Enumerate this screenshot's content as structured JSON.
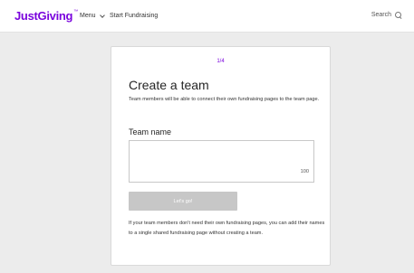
{
  "header": {
    "logo_text": "JustGiving",
    "logo_mark": "™",
    "menu_label": "Menu",
    "start_label": "Start Fundraising",
    "search_label": "Search"
  },
  "card": {
    "step": "1/4",
    "title": "Create a team",
    "description": "Team members will be able to connect their own fundraising pages to the team page.",
    "field_label": "Team name",
    "field_value": "",
    "char_count": "100",
    "button_label": "Let's go!",
    "note": "If your team members don't need their own fundraising pages, you can add their names to a single shared fundraising page without creating a team."
  },
  "colors": {
    "brand": "#7a04dd",
    "button_disabled": "#c7c7c7"
  }
}
